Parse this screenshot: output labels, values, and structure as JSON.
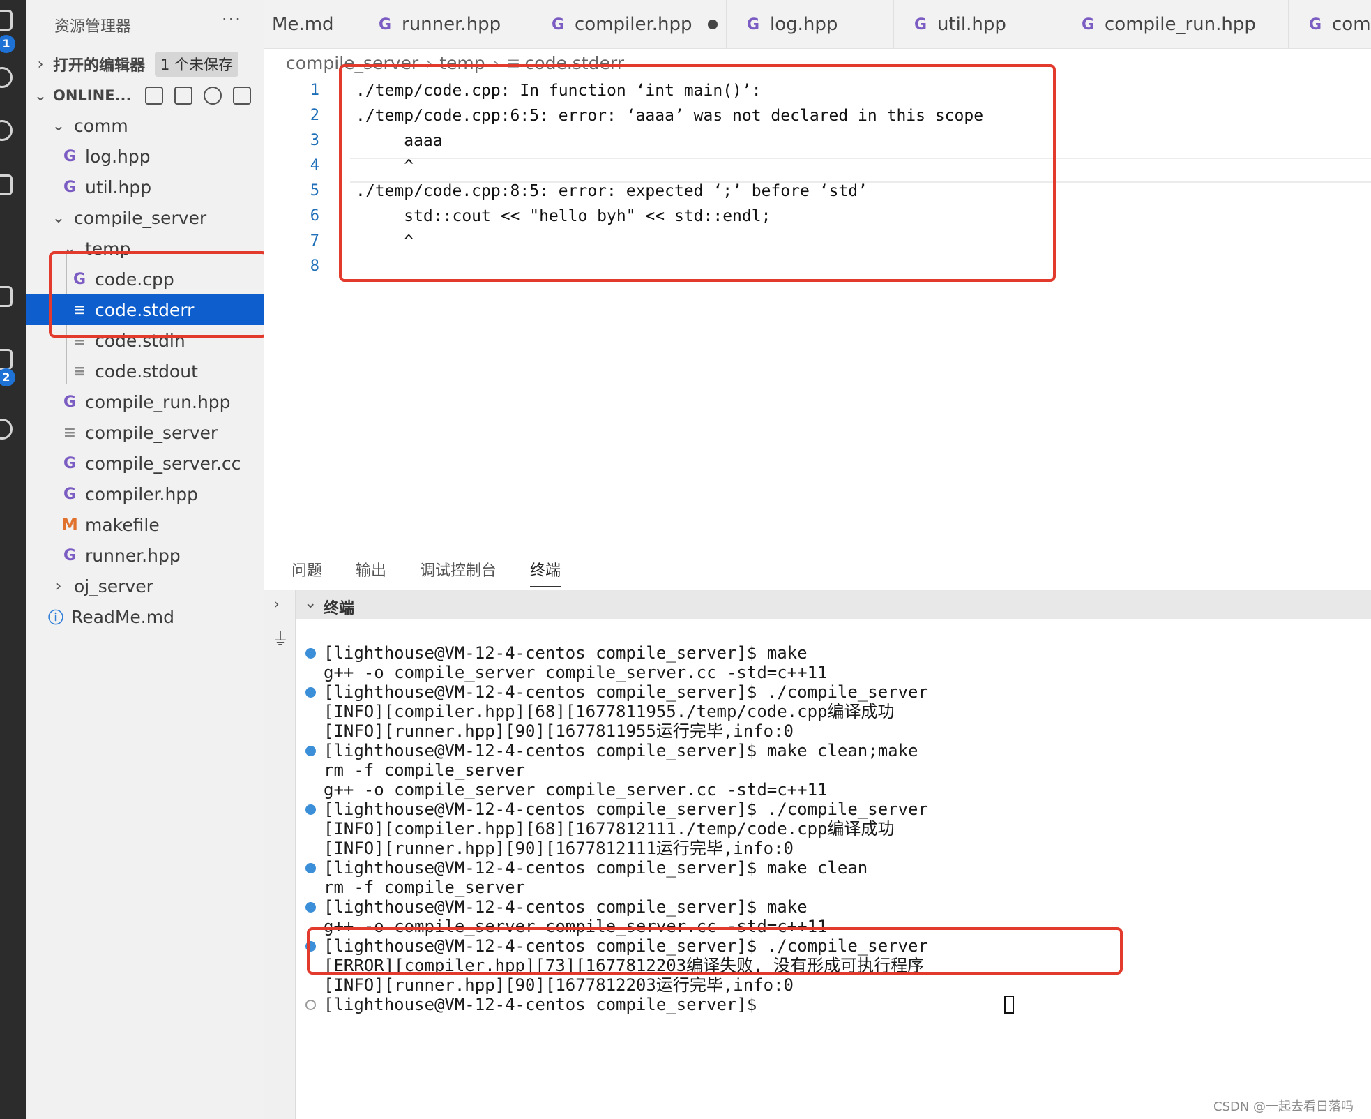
{
  "activity_bar": {
    "badge_1": "1",
    "badge_2": "2"
  },
  "sidebar": {
    "title": "资源管理器",
    "more": "···",
    "open_editors": {
      "label": "打开的编辑器",
      "unsaved": "1 个未保存"
    },
    "workspace_label": "ONLINE...",
    "tree": [
      {
        "label": "comm",
        "type": "folder"
      },
      {
        "label": "log.hpp",
        "type": "cpp"
      },
      {
        "label": "util.hpp",
        "type": "cpp"
      },
      {
        "label": "compile_server",
        "type": "folder"
      },
      {
        "label": "temp",
        "type": "folder"
      },
      {
        "label": "code.cpp",
        "type": "cpp"
      },
      {
        "label": "code.stderr",
        "type": "text",
        "selected": true
      },
      {
        "label": "code.stdin",
        "type": "text"
      },
      {
        "label": "code.stdout",
        "type": "text"
      },
      {
        "label": "compile_run.hpp",
        "type": "cpp"
      },
      {
        "label": "compile_server",
        "type": "text"
      },
      {
        "label": "compile_server.cc",
        "type": "cpp"
      },
      {
        "label": "compiler.hpp",
        "type": "cpp"
      },
      {
        "label": "makefile",
        "type": "makefile"
      },
      {
        "label": "runner.hpp",
        "type": "cpp"
      },
      {
        "label": "oj_server",
        "type": "folder-collapsed"
      },
      {
        "label": "ReadMe.md",
        "type": "info"
      }
    ]
  },
  "tabs": [
    {
      "label": "Me.md"
    },
    {
      "label": "runner.hpp"
    },
    {
      "label": "compiler.hpp",
      "dirty": true
    },
    {
      "label": "log.hpp"
    },
    {
      "label": "util.hpp"
    },
    {
      "label": "compile_run.hpp"
    },
    {
      "label": "com"
    }
  ],
  "breadcrumb": [
    "compile_server",
    "temp",
    "code.stderr"
  ],
  "editor": {
    "line_numbers": [
      "1",
      "2",
      "3",
      "4",
      "5",
      "6",
      "7",
      "8"
    ],
    "lines": [
      "./temp/code.cpp: In function ‘int main()’:",
      "./temp/code.cpp:6:5: error: ‘aaaa’ was not declared in this scope",
      "     aaaa",
      "     ^",
      "./temp/code.cpp:8:5: error: expected ‘;’ before ‘std’",
      "     std::cout << \"hello byh\" << std::endl;",
      "     ^",
      ""
    ]
  },
  "panel": {
    "tabs": [
      "问题",
      "输出",
      "调试控制台",
      "终端"
    ],
    "active_tab": "终端",
    "terminal_header": "终端",
    "terminal_lines": [
      {
        "text": "[lighthouse@VM-12-4-centos compile_server]$ make",
        "dot": "filled"
      },
      {
        "text": "g++ -o compile_server compile_server.cc -std=c++11",
        "dot": ""
      },
      {
        "text": "[lighthouse@VM-12-4-centos compile_server]$ ./compile_server",
        "dot": "filled"
      },
      {
        "text": "[INFO][compiler.hpp][68][1677811955./temp/code.cpp编译成功",
        "dot": ""
      },
      {
        "text": "[INFO][runner.hpp][90][1677811955运行完毕,info:0",
        "dot": ""
      },
      {
        "text": "[lighthouse@VM-12-4-centos compile_server]$ make clean;make",
        "dot": "filled"
      },
      {
        "text": "rm -f compile_server",
        "dot": ""
      },
      {
        "text": "g++ -o compile_server compile_server.cc -std=c++11",
        "dot": ""
      },
      {
        "text": "[lighthouse@VM-12-4-centos compile_server]$ ./compile_server",
        "dot": "filled"
      },
      {
        "text": "[INFO][compiler.hpp][68][1677812111./temp/code.cpp编译成功",
        "dot": ""
      },
      {
        "text": "[INFO][runner.hpp][90][1677812111运行完毕,info:0",
        "dot": ""
      },
      {
        "text": "[lighthouse@VM-12-4-centos compile_server]$ make clean",
        "dot": "filled"
      },
      {
        "text": "rm -f compile_server",
        "dot": ""
      },
      {
        "text": "[lighthouse@VM-12-4-centos compile_server]$ make",
        "dot": "filled"
      },
      {
        "text": "g++ -o compile_server compile_server.cc -std=c++11",
        "dot": ""
      },
      {
        "text": "[lighthouse@VM-12-4-centos compile_server]$ ./compile_server",
        "dot": "filled"
      },
      {
        "text": "[ERROR][compiler.hpp][73][1677812203编译失败, 没有形成可执行程序",
        "dot": ""
      },
      {
        "text": "[INFO][runner.hpp][90][1677812203运行完毕,info:0",
        "dot": ""
      },
      {
        "text": "[lighthouse@VM-12-4-centos compile_server]$ ",
        "dot": "hollow"
      }
    ]
  },
  "watermark": "CSDN @一起去看日落吗",
  "colors": {
    "accent": "#0e5fcd",
    "annotation": "#e23a2c",
    "cpp_icon": "#7b5cc2",
    "terminal_dot": "#3b8ed8"
  }
}
